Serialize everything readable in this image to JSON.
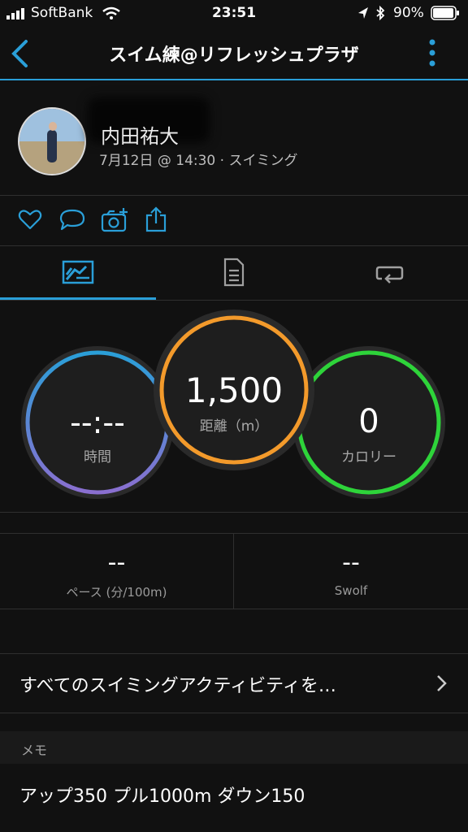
{
  "status_bar": {
    "carrier": "SoftBank",
    "time": "23:51",
    "battery": "90%"
  },
  "nav": {
    "title": "スイム練@リフレッシュプラザ",
    "back_icon": "chevron-left-icon",
    "menu_icon": "more-vertical-icon"
  },
  "activity": {
    "user_name": "内田祐大",
    "meta": "7月12日 @ 14:30 · スイミング"
  },
  "actions": [
    "heart-icon",
    "comment-icon",
    "add-photo-icon",
    "share-icon"
  ],
  "tabs": [
    "summary-tab-icon",
    "details-tab-icon",
    "laps-tab-icon"
  ],
  "circles": {
    "time": {
      "value": "--:--",
      "label": "時間"
    },
    "distance": {
      "value": "1,500",
      "label": "距離（m）"
    },
    "calories": {
      "value": "0",
      "label": "カロリー"
    }
  },
  "stats": {
    "pace": {
      "value": "--",
      "label": "ペース (分/100m)"
    },
    "swolf": {
      "value": "--",
      "label": "Swolf"
    }
  },
  "all_activities": {
    "label": "すべてのスイミングアクティビティを…"
  },
  "memo": {
    "header": "メモ",
    "text": "アップ350  プル1000m  ダウン150"
  },
  "colors": {
    "accent": "#2a9fd8",
    "time_ring": "#7b6fd0",
    "distance_ring": "#f39a2b",
    "calories_ring": "#2ed43a"
  }
}
